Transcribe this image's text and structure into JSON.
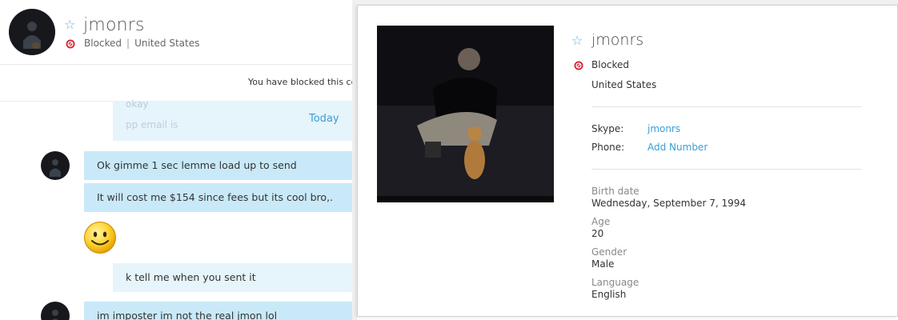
{
  "conversation": {
    "contact_name": "jmonrs",
    "status": "Blocked",
    "country": "United States",
    "blocked_notice": "You have blocked this co",
    "prev_message_line1": "okay",
    "prev_message_line2": "pp email is",
    "day_separator": "Today",
    "messages": [
      {
        "text": "Ok gimme 1 sec lemme load up to send"
      },
      {
        "text": "It will cost me $154 since fees but its cool bro,."
      },
      {
        "text": "k tell me when you sent it"
      },
      {
        "text": "im imposter im not the real jmon lol"
      }
    ]
  },
  "profile": {
    "name": "jmonrs",
    "status": "Blocked",
    "country": "United States",
    "skype_label": "Skype:",
    "skype_value": "jmonrs",
    "phone_label": "Phone:",
    "phone_action": "Add Number",
    "fields": [
      {
        "label": "Birth date",
        "value": "Wednesday, September 7, 1994"
      },
      {
        "label": "Age",
        "value": "20"
      },
      {
        "label": "Gender",
        "value": "Male"
      },
      {
        "label": "Language",
        "value": "English"
      }
    ]
  },
  "icons": {
    "favorite": "star-outline-icon",
    "blocked": "blocked-icon",
    "emoticon": "smiley-emoticon"
  },
  "colors": {
    "accent": "#3a9ed6",
    "incoming_bubble": "#c9e9f8",
    "outgoing_bubble": "#e6f4fb",
    "blocked_red": "#d9232e"
  }
}
